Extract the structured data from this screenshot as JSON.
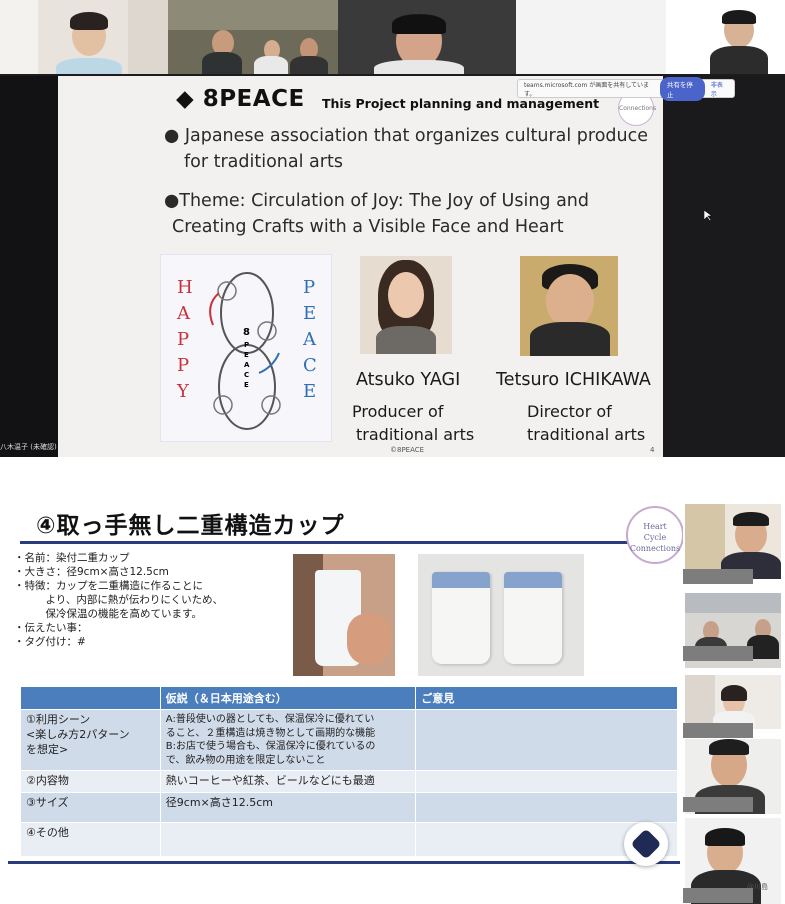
{
  "top_meeting": {
    "share_notice": {
      "text": "teams.microsoft.com が画面を共有しています。",
      "stop_label": "共有を停止",
      "hide_label": "非表示"
    },
    "name_tag": "八木温子 (未確認)",
    "slide": {
      "brand": "◆ 8PEACE",
      "subtitle": "This Project planning and management",
      "line1a": "● Japanese association that organizes cultural produce",
      "line1b": "for traditional arts",
      "line2a": "●Theme: Circulation of Joy: The Joy of Using and",
      "line2b": "Creating Crafts with a Visible Face and Heart",
      "logo_logo": {
        "left_letters": [
          "H",
          "A",
          "P",
          "P",
          "Y"
        ],
        "right_letters": [
          "P",
          "E",
          "A",
          "C",
          "E"
        ],
        "center_text": [
          "8",
          "P",
          "E",
          "A",
          "C",
          "E"
        ]
      },
      "person1": {
        "name": "Atsuko YAGI",
        "role1": "Producer of",
        "role2": "traditional arts"
      },
      "person2": {
        "name": "Tetsuro ICHIKAWA",
        "role1": "Director  of",
        "role2": "traditional arts"
      },
      "copyright": "©8PEACE",
      "page_number": "4",
      "corner_logo_text": "Connections"
    }
  },
  "bottom_meeting": {
    "title": "④取っ手無し二重構造カップ",
    "logo_lines": [
      "Heart",
      "Cycle",
      "Connections"
    ],
    "specs": [
      "・名前：染付二重カップ",
      "・大きさ：径9cm×高さ12.5cm",
      "・特徴：カップを二重構造に作ることに",
      "　　　より、内部に熱が伝わりにくいため、",
      "　　　保冷保温の機能を高めています。",
      "・伝えたい事：",
      "・タグ付け：#"
    ],
    "table": {
      "headers": [
        "",
        "仮説（＆日本用途含む）",
        "ご意見"
      ],
      "rows": [
        {
          "label": [
            "①利用シーン",
            "<楽しみ方2パターン",
            "を想定>"
          ],
          "hypothesis": [
            "A:普段使いの器としても、保温保冷に優れてい",
            "ること、２重構造は焼き物として画期的な機能",
            "B:お店で使う場合も、保温保冷に優れているの",
            "で、飲み物の用途を限定しないこと"
          ],
          "opinion": ""
        },
        {
          "label": [
            "②内容物"
          ],
          "hypothesis": [
            "熱いコーヒーや紅茶、ビールなどにも最適"
          ],
          "opinion": ""
        },
        {
          "label": [
            "③サイズ"
          ],
          "hypothesis": [
            "径9cm×高さ12.5cm"
          ],
          "opinion": ""
        },
        {
          "label": [
            "④その他"
          ],
          "hypothesis": [
            ""
          ],
          "opinion": ""
        }
      ]
    },
    "side_tag": "@川島"
  }
}
